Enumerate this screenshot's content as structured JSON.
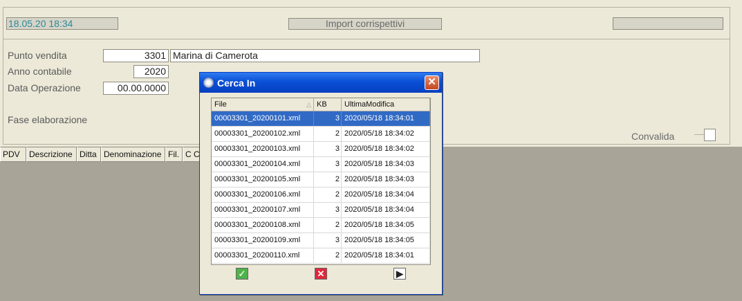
{
  "header": {
    "datetime": "18.05.20 18:34",
    "title": "Import corrispettivi"
  },
  "form": {
    "punto_vendita_label": "Punto vendita",
    "punto_vendita_code": "3301",
    "punto_vendita_name": "Marina di Camerota",
    "anno_label": "Anno contabile",
    "anno_value": "2020",
    "data_op_label": "Data Operazione",
    "data_op_value": "00.00.0000",
    "fase_label": "Fase elaborazione",
    "convalida_label": "Convalida"
  },
  "table_columns": [
    "PDV",
    "Descrizione",
    "Ditta",
    "Denominazione",
    "Fil.",
    "C Cl"
  ],
  "dialog": {
    "title": "Cerca In",
    "close_glyph": "✕",
    "columns": [
      "File",
      "KB",
      "UltimaModifica"
    ],
    "sort_indicator": "△",
    "rows": [
      {
        "file": "00003301_20200101.xml",
        "kb": "3",
        "modified": "2020/05/18 18:34:01",
        "selected": true
      },
      {
        "file": "00003301_20200102.xml",
        "kb": "2",
        "modified": "2020/05/18 18:34:02"
      },
      {
        "file": "00003301_20200103.xml",
        "kb": "3",
        "modified": "2020/05/18 18:34:02"
      },
      {
        "file": "00003301_20200104.xml",
        "kb": "3",
        "modified": "2020/05/18 18:34:03"
      },
      {
        "file": "00003301_20200105.xml",
        "kb": "2",
        "modified": "2020/05/18 18:34:03"
      },
      {
        "file": "00003301_20200106.xml",
        "kb": "2",
        "modified": "2020/05/18 18:34:04"
      },
      {
        "file": "00003301_20200107.xml",
        "kb": "3",
        "modified": "2020/05/18 18:34:04"
      },
      {
        "file": "00003301_20200108.xml",
        "kb": "2",
        "modified": "2020/05/18 18:34:05"
      },
      {
        "file": "00003301_20200109.xml",
        "kb": "3",
        "modified": "2020/05/18 18:34:05"
      },
      {
        "file": "00003301_20200110.xml",
        "kb": "2",
        "modified": "2020/05/18 18:34:01"
      }
    ],
    "ok_glyph": "✓",
    "cancel_glyph": "✕",
    "next_glyph": "▶"
  }
}
